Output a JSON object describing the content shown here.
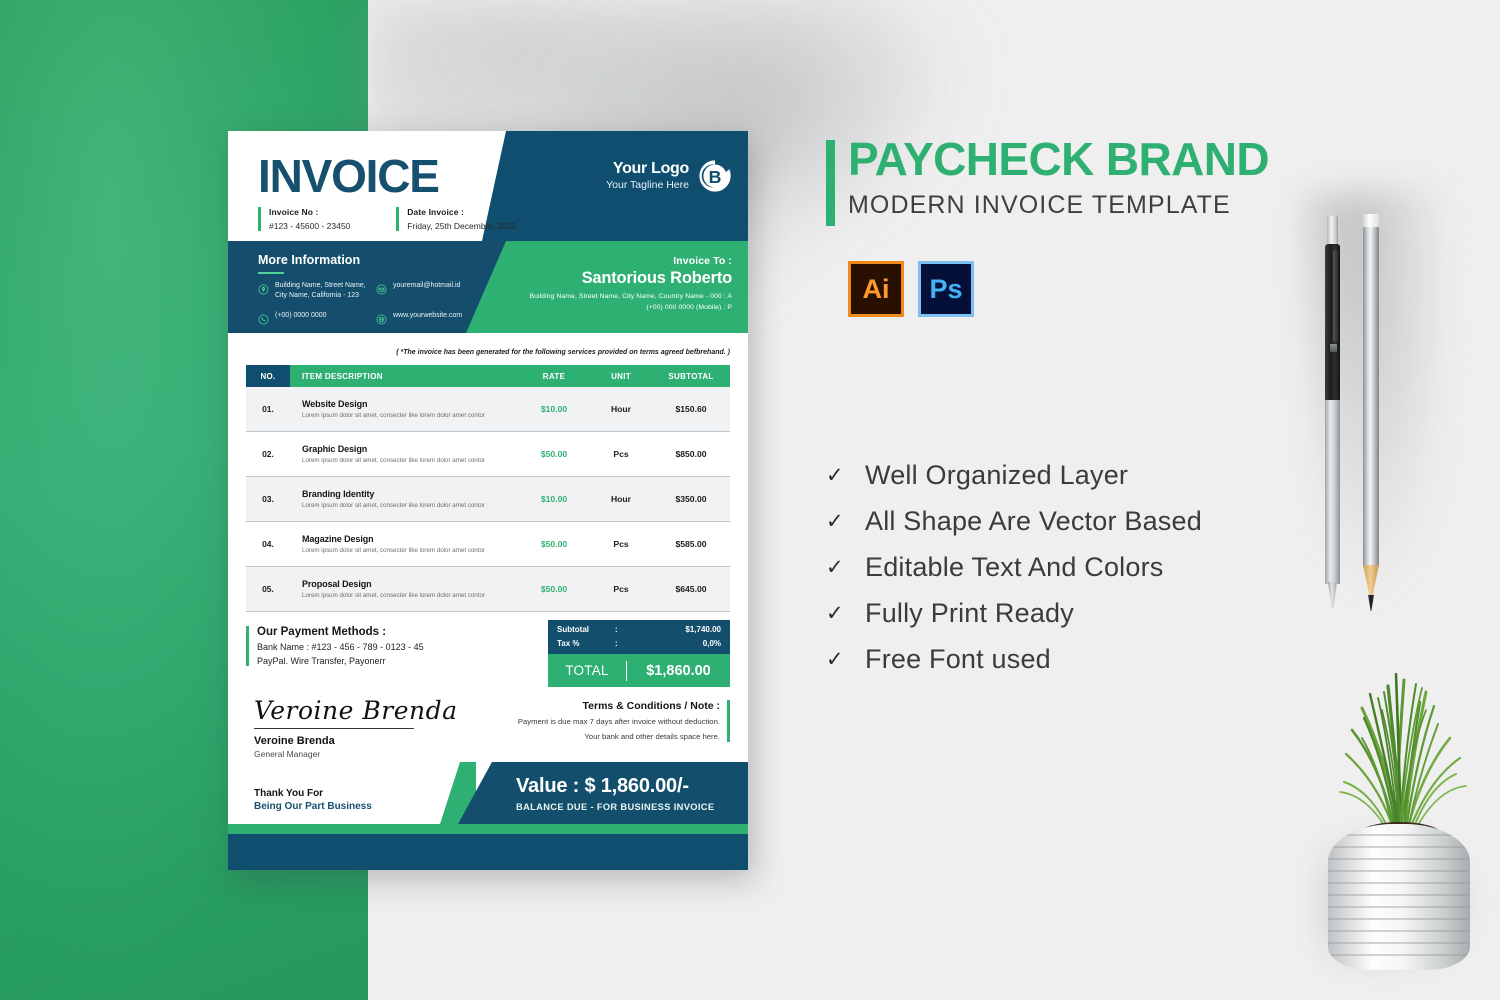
{
  "promo": {
    "brand_title": "PAYCHECK BRAND",
    "subtitle": "MODERN INVOICE TEMPLATE",
    "badges": [
      {
        "name": "adobe-illustrator",
        "label": "Ai"
      },
      {
        "name": "adobe-photoshop",
        "label": "Ps"
      }
    ],
    "check_glyph": "✓",
    "features": [
      "Well Organized Layer",
      "All Shape Are Vector Based",
      "Editable Text And Colors",
      "Fully Print Ready",
      "Free Font used"
    ]
  },
  "invoice": {
    "title": "INVOICE",
    "meta": [
      {
        "label": "Invoice No :",
        "value": "#123 - 45600 - 23450"
      },
      {
        "label": "Date Invoice :",
        "value": "Friday, 25th December, 2023"
      }
    ],
    "logo": {
      "name": "Your Logo",
      "tagline": "Your Tagline Here",
      "mark_letter": "B"
    },
    "more_information": {
      "title": "More Information",
      "contacts": [
        {
          "icon": "location-pin-icon",
          "text": "Building Name, Street Name, City Name, California - 123"
        },
        {
          "icon": "envelope-icon",
          "text": "youremail@hotmail.id"
        },
        {
          "icon": "phone-icon",
          "text": "(+00) 0000 0000"
        },
        {
          "icon": "globe-icon",
          "text": "www.yourwebsite.com"
        }
      ]
    },
    "invoice_to": {
      "label": "Invoice To :",
      "name": "Santorious Roberto",
      "address": "Building Name, Street Name, City Name, Country Name - 000   : A",
      "phone": "(+00) 000 0000 (Mobile)   : P"
    },
    "note": "( *The invoice has been generated for the following services provided on terms agreed befbrehand. )",
    "table": {
      "headers": [
        "NO.",
        "ITEM DESCRIPTION",
        "RATE",
        "UNIT",
        "SUBTOTAL"
      ],
      "rows": [
        {
          "no": "01.",
          "item": "Website Design",
          "desc": "Lorem ipsum dolor sit amet, consecter like lorem dolor amet contor",
          "rate": "$10.00",
          "unit": "Hour",
          "subtotal": "$150.60"
        },
        {
          "no": "02.",
          "item": "Graphic Design",
          "desc": "Lorem ipsum dolor sit amet, consecter like lorem dolor amet contor",
          "rate": "$50.00",
          "unit": "Pcs",
          "subtotal": "$850.00"
        },
        {
          "no": "03.",
          "item": "Branding Identity",
          "desc": "Lorem ipsum dolor sit amet, consecter like lorem dolor amet contor",
          "rate": "$10.00",
          "unit": "Hour",
          "subtotal": "$350.00"
        },
        {
          "no": "04.",
          "item": "Magazine Design",
          "desc": "Lorem ipsum dolor sit amet, consecter like lorem dolor amet contor",
          "rate": "$50.00",
          "unit": "Pcs",
          "subtotal": "$585.00"
        },
        {
          "no": "05.",
          "item": "Proposal Design",
          "desc": "Lorem ipsum dolor sit amet, consecter like lorem dolor amet contor",
          "rate": "$50.00",
          "unit": "Pcs",
          "subtotal": "$645.00"
        }
      ]
    },
    "payment_methods": {
      "title": "Our Payment Methods :",
      "line1": "Bank Name : #123 - 456 - 789 - 0123 - 45",
      "line2": "PayPal. Wire Transfer, Payonerr"
    },
    "totals": {
      "subtotal_label": "Subtotal",
      "subtotal_sep": ":",
      "subtotal_value": "$1,740.00",
      "tax_label": "Tax %",
      "tax_sep": ":",
      "tax_value": "0,0%",
      "total_label": "TOTAL",
      "total_value": "$1,860.00"
    },
    "signature": {
      "script": "Veroine Brenda",
      "name": "Veroine Brenda",
      "role": "General Manager"
    },
    "thanks": {
      "line1": "Thank You For",
      "line2": "Being Our Part Business"
    },
    "terms": {
      "title": "Terms & Conditions / Note :",
      "line1": "Payment is due max 7 days after invoice without deduction.",
      "line2": "Your bank and other details space here."
    },
    "value_bar": {
      "label": "Value :",
      "amount": "$ 1,860.00/-",
      "caption": "BALANCE DUE - FOR BUSINESS INVOICE"
    }
  },
  "colors": {
    "dark_teal": "#124e6d",
    "green": "#2fb073",
    "bg_green": "#2fae6c",
    "bg_gray": "#efefef",
    "rate_green": "#2fb073"
  },
  "props": {
    "pen": "ballpoint-pen",
    "pencil": "graphite-pencil",
    "plant": "potted-grass-plant"
  }
}
